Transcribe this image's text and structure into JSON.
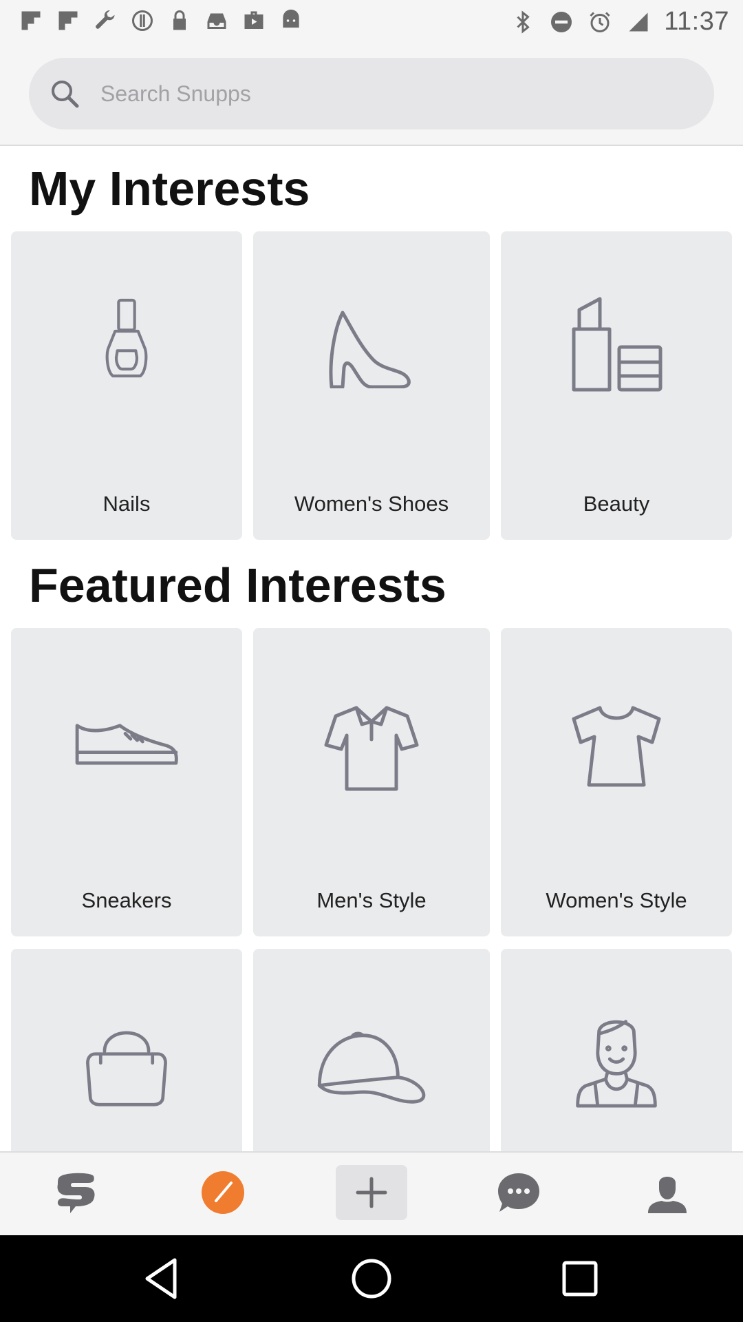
{
  "status_bar": {
    "time": "11:37",
    "left_icons": [
      "flipboard-icon",
      "flipboard-icon",
      "wrench-icon",
      "info-icon",
      "lock-icon",
      "inbox-check-icon",
      "briefcase-icon",
      "android-icon"
    ],
    "right_icons": [
      "bluetooth-icon",
      "do-not-disturb-icon",
      "alarm-icon",
      "signal-icon"
    ]
  },
  "search": {
    "placeholder": "Search Snupps"
  },
  "my_interests": {
    "title": "My Interests",
    "items": [
      {
        "label": "Nails",
        "icon": "nail-polish-icon"
      },
      {
        "label": "Women's Shoes",
        "icon": "high-heel-icon"
      },
      {
        "label": "Beauty",
        "icon": "lipstick-icon"
      }
    ]
  },
  "featured_interests": {
    "title": "Featured Interests",
    "items": [
      {
        "label": "Sneakers",
        "icon": "sneaker-icon"
      },
      {
        "label": "Men's Style",
        "icon": "polo-shirt-icon"
      },
      {
        "label": "Women's Style",
        "icon": "blouse-icon"
      },
      {
        "label": "",
        "icon": "handbag-icon"
      },
      {
        "label": "",
        "icon": "cap-icon"
      },
      {
        "label": "",
        "icon": "person-icon"
      }
    ]
  },
  "bottom_nav": {
    "active_color": "#f07d2f",
    "items": [
      "snupps-logo-icon",
      "explore-compass-icon",
      "add-icon",
      "messages-icon",
      "profile-icon"
    ]
  },
  "system_nav": [
    "back-icon",
    "home-icon",
    "recents-icon"
  ]
}
